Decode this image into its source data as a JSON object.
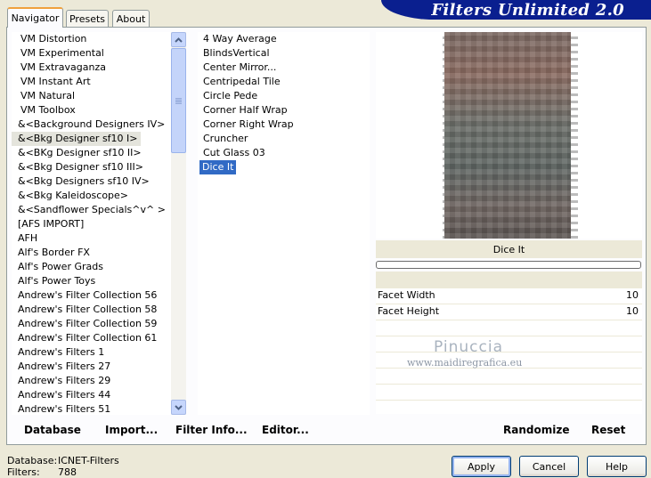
{
  "window": {
    "brand": "Filters Unlimited 2.0"
  },
  "tabs": [
    {
      "label": "Navigator",
      "active": true
    },
    {
      "label": "Presets",
      "active": false
    },
    {
      "label": "About",
      "active": false
    }
  ],
  "categories": {
    "items": [
      "VM Distortion",
      "VM Experimental",
      "VM Extravaganza",
      "VM Instant Art",
      "VM Natural",
      "VM Toolbox",
      "&<Background Designers IV>",
      "&<Bkg Designer sf10 I>",
      "&<BKg Designer sf10 II>",
      "&<Bkg Designer sf10 III>",
      "&<Bkg Designers sf10 IV>",
      "&<Bkg Kaleidoscope>",
      "&<Sandflower Specials^v^ >",
      "[AFS IMPORT]",
      "AFH",
      "Alf's Border FX",
      "Alf's Power Grads",
      "Alf's Power Toys",
      "Andrew's Filter Collection 56",
      "Andrew's Filter Collection 58",
      "Andrew's Filter Collection 59",
      "Andrew's Filter Collection 61",
      "Andrew's Filters 1",
      "Andrew's Filters 27",
      "Andrew's Filters 29",
      "Andrew's Filters 44",
      "Andrew's Filters 51"
    ],
    "selected": "&<Bkg Designer sf10 I>"
  },
  "filters": {
    "items": [
      "4 Way Average",
      "BlindsVertical",
      "Center Mirror...",
      "Centripedal Tile",
      "Circle Pede",
      "Corner Half Wrap",
      "Corner Right Wrap",
      "Cruncher",
      "Cut Glass  03",
      "Dice It"
    ],
    "selected": "Dice It"
  },
  "preview": {
    "filter_name": "Dice It",
    "progress": 0
  },
  "parameters": [
    {
      "label": "Facet Width",
      "value": "10"
    },
    {
      "label": "Facet Height",
      "value": "10"
    }
  ],
  "watermark": {
    "name": "Pinuccia",
    "url": "www.maidiregrafica.eu"
  },
  "bottom_links": {
    "database": "Database",
    "import": "Import...",
    "filter_info": "Filter Info...",
    "editor": "Editor...",
    "randomize": "Randomize",
    "reset": "Reset"
  },
  "dialog_buttons": {
    "apply": "Apply",
    "cancel": "Cancel",
    "help": "Help"
  },
  "status": {
    "database_label": "Database:",
    "database_value": "ICNET-Filters",
    "filters_label": "Filters:",
    "filters_value": "788"
  },
  "colors": {
    "banner": "#0a1f8f",
    "selection": "#316ac5",
    "background": "#ece9d8"
  }
}
